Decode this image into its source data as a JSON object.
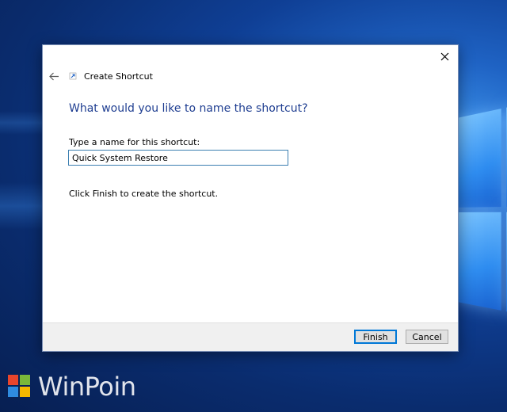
{
  "dialog": {
    "title": "Create Shortcut",
    "heading": "What would you like to name the shortcut?",
    "field_label": "Type a name for this shortcut:",
    "name_value": "Quick System Restore",
    "info_text": "Click Finish to create the shortcut.",
    "finish_label": "Finish",
    "cancel_label": "Cancel",
    "icons": {
      "back": "back-arrow-icon",
      "close": "close-icon",
      "shortcut": "shortcut-arrow-icon"
    }
  },
  "watermark": {
    "text": "WinPoin",
    "logo_colors": [
      "#e8452c",
      "#7ab83a",
      "#2f8be0",
      "#f5b800"
    ]
  },
  "colors": {
    "heading": "#1f3e91",
    "accent": "#0078d7",
    "footer_bg": "#f0f0f0"
  }
}
